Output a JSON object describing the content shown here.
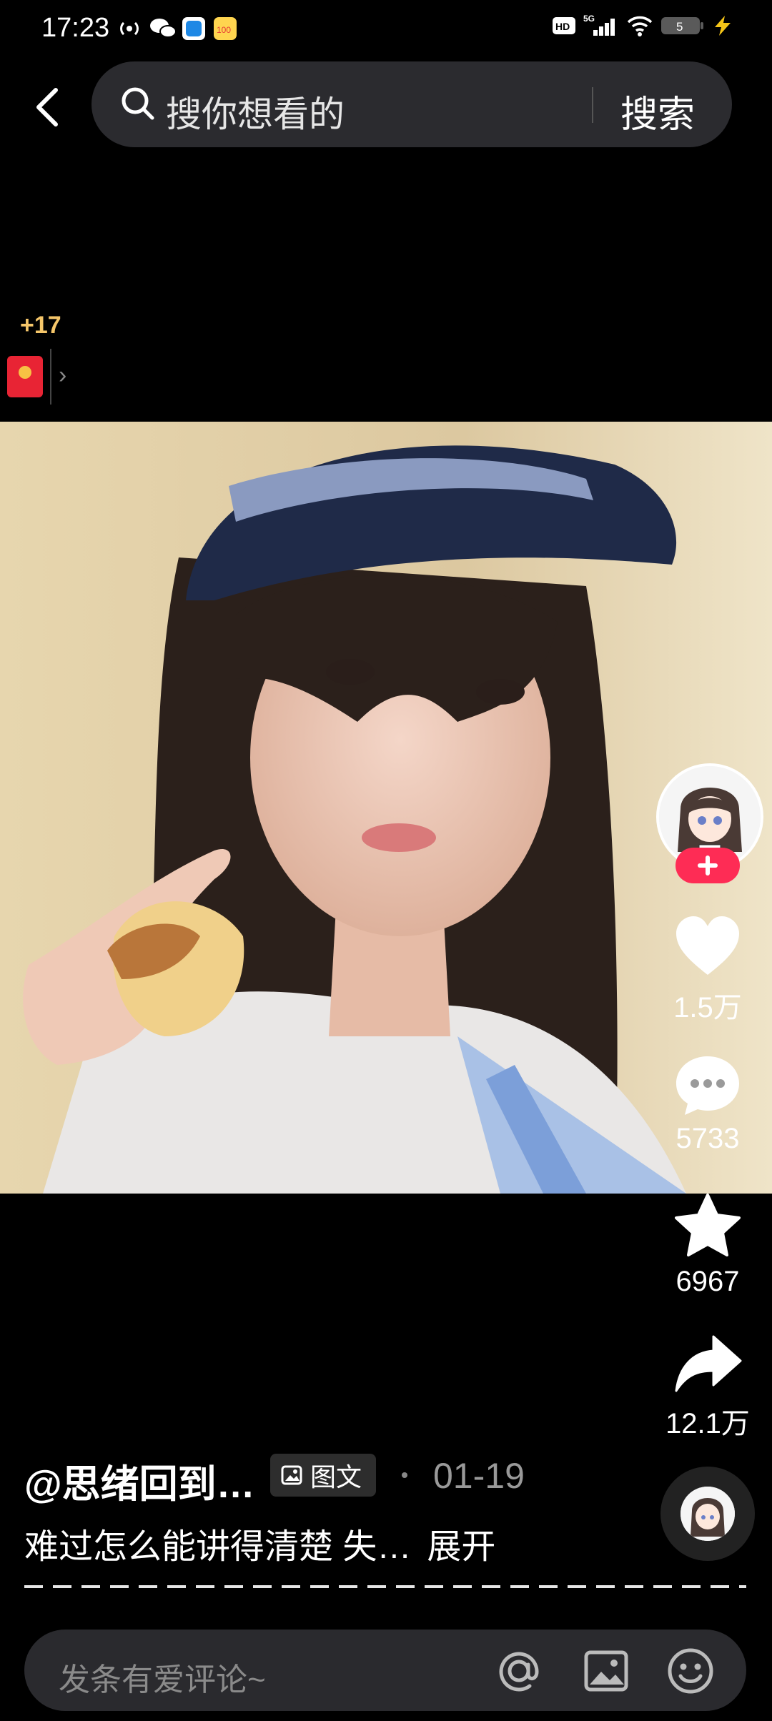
{
  "status_bar": {
    "time": "17:23",
    "hd": "HD",
    "network": "5G",
    "battery": "5"
  },
  "header": {
    "search_placeholder": "搜你想看的",
    "search_button": "搜索"
  },
  "reward": {
    "bonus_text": "+17"
  },
  "actions": {
    "likes": "1.5万",
    "comments": "5733",
    "favorites": "6967",
    "shares": "12.1万"
  },
  "post": {
    "author": "@思绪回到…",
    "type_tag": "图文",
    "date": "01-19",
    "caption": "难过怎么能讲得清楚 失…",
    "expand_label": "展开"
  },
  "comment_bar": {
    "placeholder": "发条有爱评论~"
  },
  "colors": {
    "accent": "#fe2c55",
    "bonus": "#f5c66a",
    "background": "#000000"
  }
}
